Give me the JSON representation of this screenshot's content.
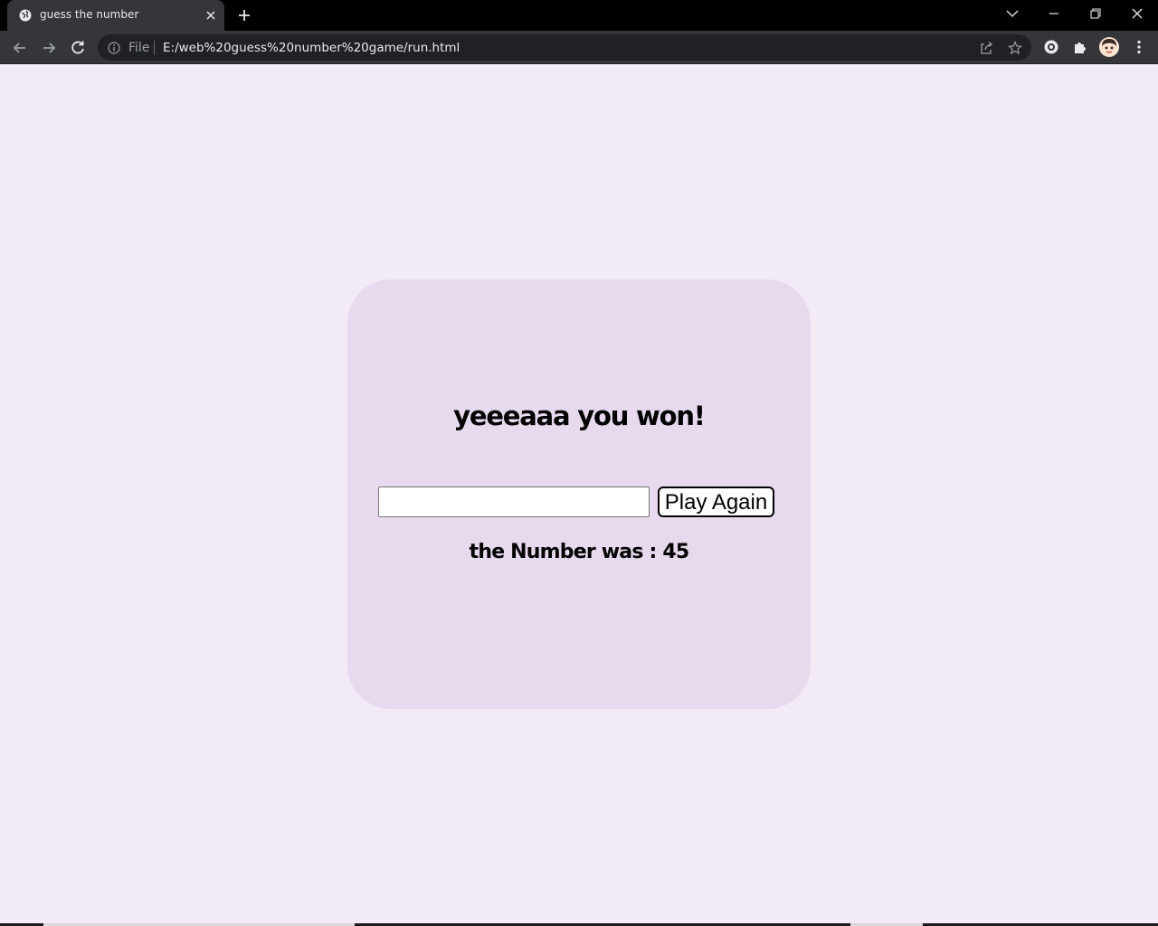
{
  "browser": {
    "tab_title": "guess the number",
    "omnibox": {
      "scheme_label": "File",
      "url": "E:/web%20guess%20number%20game/run.html"
    },
    "icons": {
      "favicon": "globe-icon",
      "tab_close": "close-icon",
      "new_tab": "plus-icon",
      "tab_search": "chevron-down-icon",
      "minimize": "minimize-icon",
      "restore": "restore-icon",
      "close_window": "close-icon",
      "back": "arrow-left-icon",
      "forward": "arrow-right-icon",
      "reload": "reload-icon",
      "site_info": "info-icon",
      "share": "share-icon",
      "bookmark": "star-icon",
      "extension_1": "extension-icon",
      "extensions": "puzzle-icon",
      "profile": "avatar",
      "menu": "kebab-menu-icon"
    }
  },
  "game": {
    "heading": "yeeeaaa you won!",
    "guess_input_value": "",
    "play_again_label": "Play Again",
    "result_text": "the Number was : 45"
  },
  "colors": {
    "page_background": "#f3eaf7",
    "card_background": "#e8daee",
    "chrome_dark": "#35363a",
    "tabstrip": "#000000"
  }
}
